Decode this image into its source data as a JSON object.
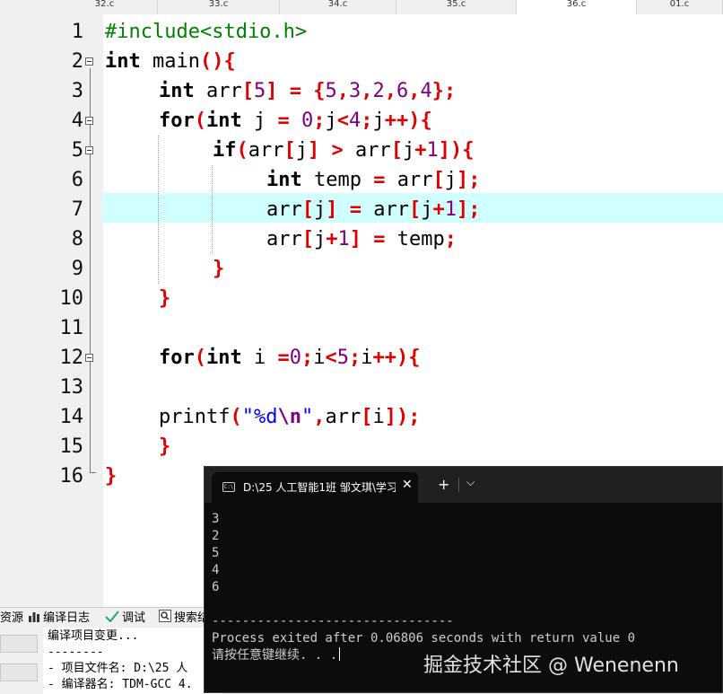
{
  "tabs": [
    "32.c",
    "33.c",
    "34.c",
    "35.c",
    "36.c",
    "01.c"
  ],
  "active_tab": "36.c",
  "line_numbers": [
    "1",
    "2",
    "3",
    "4",
    "5",
    "6",
    "7",
    "8",
    "9",
    "10",
    "11",
    "12",
    "13",
    "14",
    "15",
    "16"
  ],
  "code": {
    "l1": {
      "a": "#include<stdio.h>"
    },
    "l2": {
      "a": "int",
      "b": " main",
      "c": "(){"
    },
    "l3": {
      "a": "int",
      "b": " arr",
      "c": "[",
      "d": "5",
      "e": "]",
      "f": " = ",
      "g": "{",
      "h": "5",
      "i": ",",
      "j": "3",
      "k": ",",
      "l": "2",
      "m": ",",
      "n": "6",
      "o": ",",
      "p": "4",
      "q": "};"
    },
    "l4": {
      "a": "for",
      "b": "(",
      "c": "int",
      "d": " j ",
      "e": "=",
      "f": " ",
      "g": "0",
      "h": ";",
      "i": "j",
      "j": "<",
      "k": "4",
      "l": ";",
      "m": "j",
      "n": "++",
      "o": "){"
    },
    "l5": {
      "a": "if",
      "b": "(",
      "c": "arr",
      "d": "[",
      "e": "j",
      "f": "]",
      "g": " > ",
      "h": "arr",
      "i": "[",
      "j": "j",
      "k": "+",
      "l": "1",
      "m": "]){"
    },
    "l6": {
      "a": "int",
      "b": " temp ",
      "c": "=",
      "d": " arr",
      "e": "[",
      "f": "j",
      "g": "];"
    },
    "l7": {
      "a": "arr",
      "b": "[",
      "c": "j",
      "d": "]",
      "e": " = ",
      "f": "arr",
      "g": "[",
      "h": "j",
      "i": "+",
      "j": "1",
      "k": "];"
    },
    "l8": {
      "a": "arr",
      "b": "[",
      "c": "j",
      "d": "+",
      "e": "1",
      "f": "]",
      "g": " = ",
      "h": "temp",
      "i": ";"
    },
    "l9": {
      "a": "}"
    },
    "l10": {
      "a": "}"
    },
    "l12": {
      "a": "for",
      "b": "(",
      "c": "int",
      "d": " i ",
      "e": "=",
      "f": "0",
      "g": ";",
      "h": "i",
      "i": "<",
      "j": "5",
      "k": ";",
      "l": "i",
      "m": "++",
      "n": "){"
    },
    "l14": {
      "a": "printf",
      "b": "(",
      "c": "\"%d",
      "d": "\\n",
      "e": "\"",
      "f": ",",
      "g": "arr",
      "h": "[",
      "i": "i",
      "j": "]);"
    },
    "l15": {
      "a": "}"
    },
    "l16": {
      "a": "}"
    }
  },
  "bottom_tabs": [
    "资源",
    "编译日志",
    "调试",
    "搜索结"
  ],
  "compile_log": [
    "编译项目变更...",
    "--------",
    "- 项目文件名: D:\\25 人",
    "- 编译器名: TDM-GCC 4."
  ],
  "console": {
    "title": "D:\\25 人工智能1班 邹文琪\\学习",
    "tab_icon": "C:\\",
    "close": "✕",
    "plus": "+",
    "dropdown": "⌵",
    "output": [
      "3",
      "2",
      "5",
      "4",
      "6"
    ],
    "separator": "--------------------------------",
    "exit_msg": "Process exited after 0.06806 seconds with return value 0",
    "prompt": "请按任意键继续. . ."
  },
  "watermark": "掘金技术社区 @ Wenenenn",
  "colors": {
    "keyword": "#000000",
    "preprocessor": "#008000",
    "bracket": "#e00000",
    "number": "#800080",
    "string": "#0000ff",
    "highlight": "#d0ffff",
    "console_bg": "#0c0c0c"
  }
}
